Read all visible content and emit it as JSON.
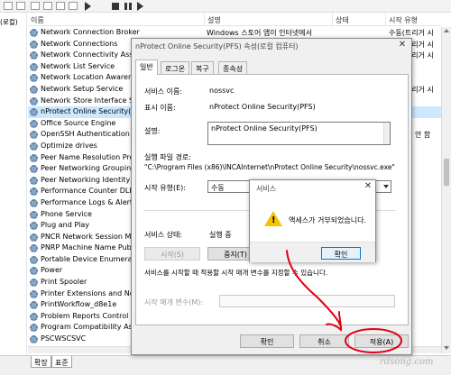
{
  "background": {
    "sidebar": {
      "label": "(로컬)"
    },
    "columns": {
      "name": "이름",
      "description": "설명",
      "status": "상태",
      "startup": "시작 유형"
    },
    "services": [
      {
        "name": "Network Connection Broker",
        "desc": "Windows 스토어 앱이 인터넷에서",
        "startup": "수동(트리거 시"
      },
      {
        "name": "Network Connections",
        "desc": "",
        "startup": "수동(트리거 시"
      },
      {
        "name": "Network Connectivity Assistant",
        "desc": "",
        "startup": "수동(트리거 시"
      },
      {
        "name": "Network List Service",
        "desc": "",
        "startup": ""
      },
      {
        "name": "Network Location Awareness",
        "desc": "",
        "startup": ""
      },
      {
        "name": "Network Setup Service",
        "desc": "",
        "startup": "수동(트리거 시"
      },
      {
        "name": "Network Store Interface Service",
        "desc": "",
        "startup": ""
      },
      {
        "name": "nProtect Online Security(PFS)",
        "desc": "",
        "startup": ""
      },
      {
        "name": "Office  Source Engine",
        "desc": "",
        "startup": ""
      },
      {
        "name": "OpenSSH Authentication Agent",
        "desc": "",
        "startup": "안 함"
      },
      {
        "name": "Optimize drives",
        "desc": "",
        "startup": ""
      },
      {
        "name": "Peer Name Resolution Protocol",
        "desc": "",
        "startup": ""
      },
      {
        "name": "Peer Networking Grouping",
        "desc": "",
        "startup": ""
      },
      {
        "name": "Peer Networking Identity Manager",
        "desc": "",
        "startup": ""
      },
      {
        "name": "Performance Counter DLL Host",
        "desc": "",
        "startup": ""
      },
      {
        "name": "Performance Logs & Alerts",
        "desc": "",
        "startup": ""
      },
      {
        "name": "Phone Service",
        "desc": "",
        "startup": ""
      },
      {
        "name": "Plug and Play",
        "desc": "",
        "startup": ""
      },
      {
        "name": "PNCR Network Session Manager",
        "desc": "",
        "startup": ""
      },
      {
        "name": "PNRP Machine Name Publication",
        "desc": "",
        "startup": ""
      },
      {
        "name": "Portable Device Enumerator",
        "desc": "",
        "startup": ""
      },
      {
        "name": "Power",
        "desc": "",
        "startup": ""
      },
      {
        "name": "Print Spooler",
        "desc": "",
        "startup": ""
      },
      {
        "name": "Printer Extensions and Notifications",
        "desc": "",
        "startup": ""
      },
      {
        "name": "PrintWorkflow_d8e1e",
        "desc": "",
        "startup": ""
      },
      {
        "name": "Problem Reports Control Panel",
        "desc": "",
        "startup": ""
      },
      {
        "name": "Program Compatibility Assistant",
        "desc": "",
        "startup": ""
      },
      {
        "name": "PSCWSCSVC",
        "desc": "",
        "startup": ""
      }
    ],
    "bottom_tabs": {
      "extended": "확장",
      "standard": "표준"
    }
  },
  "dialog": {
    "title": "nProtect Online Security(PFS) 속성(로컬 컴퓨터)",
    "close": "✕",
    "tabs": [
      "일반",
      "로그온",
      "복구",
      "종속성"
    ],
    "service_name_label": "서비스 이름:",
    "service_name_value": "nossvc",
    "display_name_label": "표시 이름:",
    "display_name_value": "nProtect Online Security(PFS)",
    "description_label": "설명:",
    "description_value": "nProtect Online Security(PFS)",
    "exe_path_label": "실행 파일 경로:",
    "exe_path_value": "\"C:\\Program Files (x86)\\INCAInternet\\nProtect Online Security\\nossvc.exe\"",
    "startup_type_label": "시작 유형(E):",
    "startup_type_value": "수동",
    "status_label": "서비스 상태:",
    "status_value": "실행 중",
    "buttons": {
      "start": "시작(S)",
      "stop": "중지(T)"
    },
    "hint": "서비스를 시작할 때 적용할 시작 매개 변수를 지정할 수 있습니다.",
    "start_params_label": "시작 매개 변수(M):",
    "footer": {
      "ok": "확인",
      "cancel": "취소",
      "apply": "적용(A)"
    }
  },
  "popup": {
    "title": "서비스",
    "close": "✕",
    "message": "액세스가 거부되었습니다.",
    "ok": "확인",
    "icon": "warning-icon"
  },
  "annotation": {
    "color": "#e0001a"
  },
  "watermark": "rdsong.com"
}
